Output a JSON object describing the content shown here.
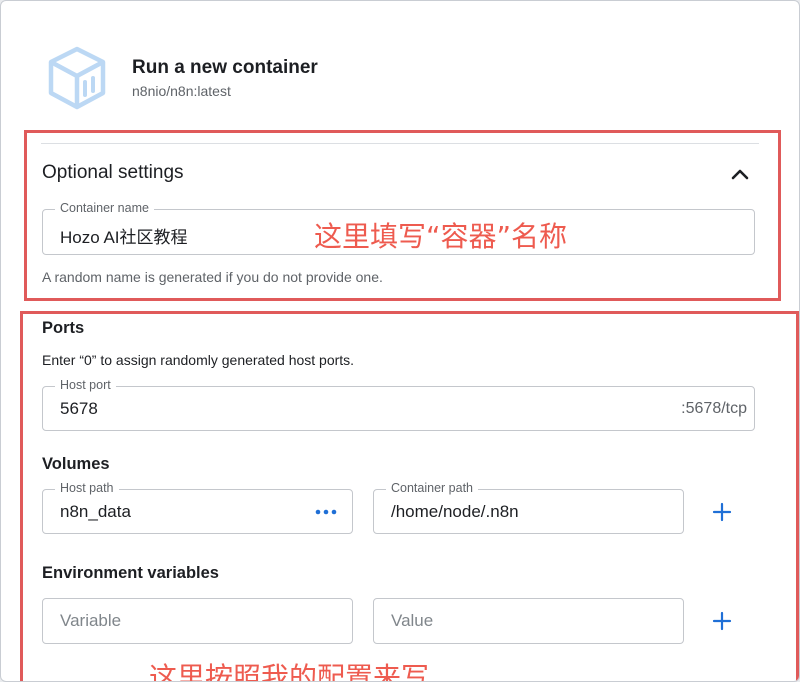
{
  "header": {
    "title": "Run a new container",
    "image": "n8nio/n8n:latest",
    "logo_icon": "cube-icon"
  },
  "optional_settings": {
    "heading": "Optional settings",
    "collapse_icon": "chevron-up-icon",
    "container_name": {
      "label": "Container name",
      "value": "Hozo AI社区教程"
    },
    "helper": "A random name is generated if you do not provide one."
  },
  "ports": {
    "heading": "Ports",
    "hint": "Enter “0” to assign randomly generated host ports.",
    "host_port": {
      "label": "Host port",
      "value": "5678",
      "suffix": ":5678/tcp"
    }
  },
  "volumes": {
    "heading": "Volumes",
    "host_path": {
      "label": "Host path",
      "value": "n8n_data",
      "browse_icon": "more-horizontal-icon"
    },
    "container_path": {
      "label": "Container path",
      "value": "/home/node/.n8n"
    },
    "add_icon": "plus-icon"
  },
  "env": {
    "heading": "Environment variables",
    "variable_placeholder": "Variable",
    "value_placeholder": "Value",
    "add_icon": "plus-icon"
  },
  "annotations": {
    "name_note": "这里填写“容器”名称",
    "bottom_note": "这里按照我的配置来写"
  },
  "colors": {
    "accent": "#1f6fd6",
    "annotation": "#e05a5a",
    "annotation_text": "#ee5b4f",
    "logo": "#bcd8f4"
  }
}
